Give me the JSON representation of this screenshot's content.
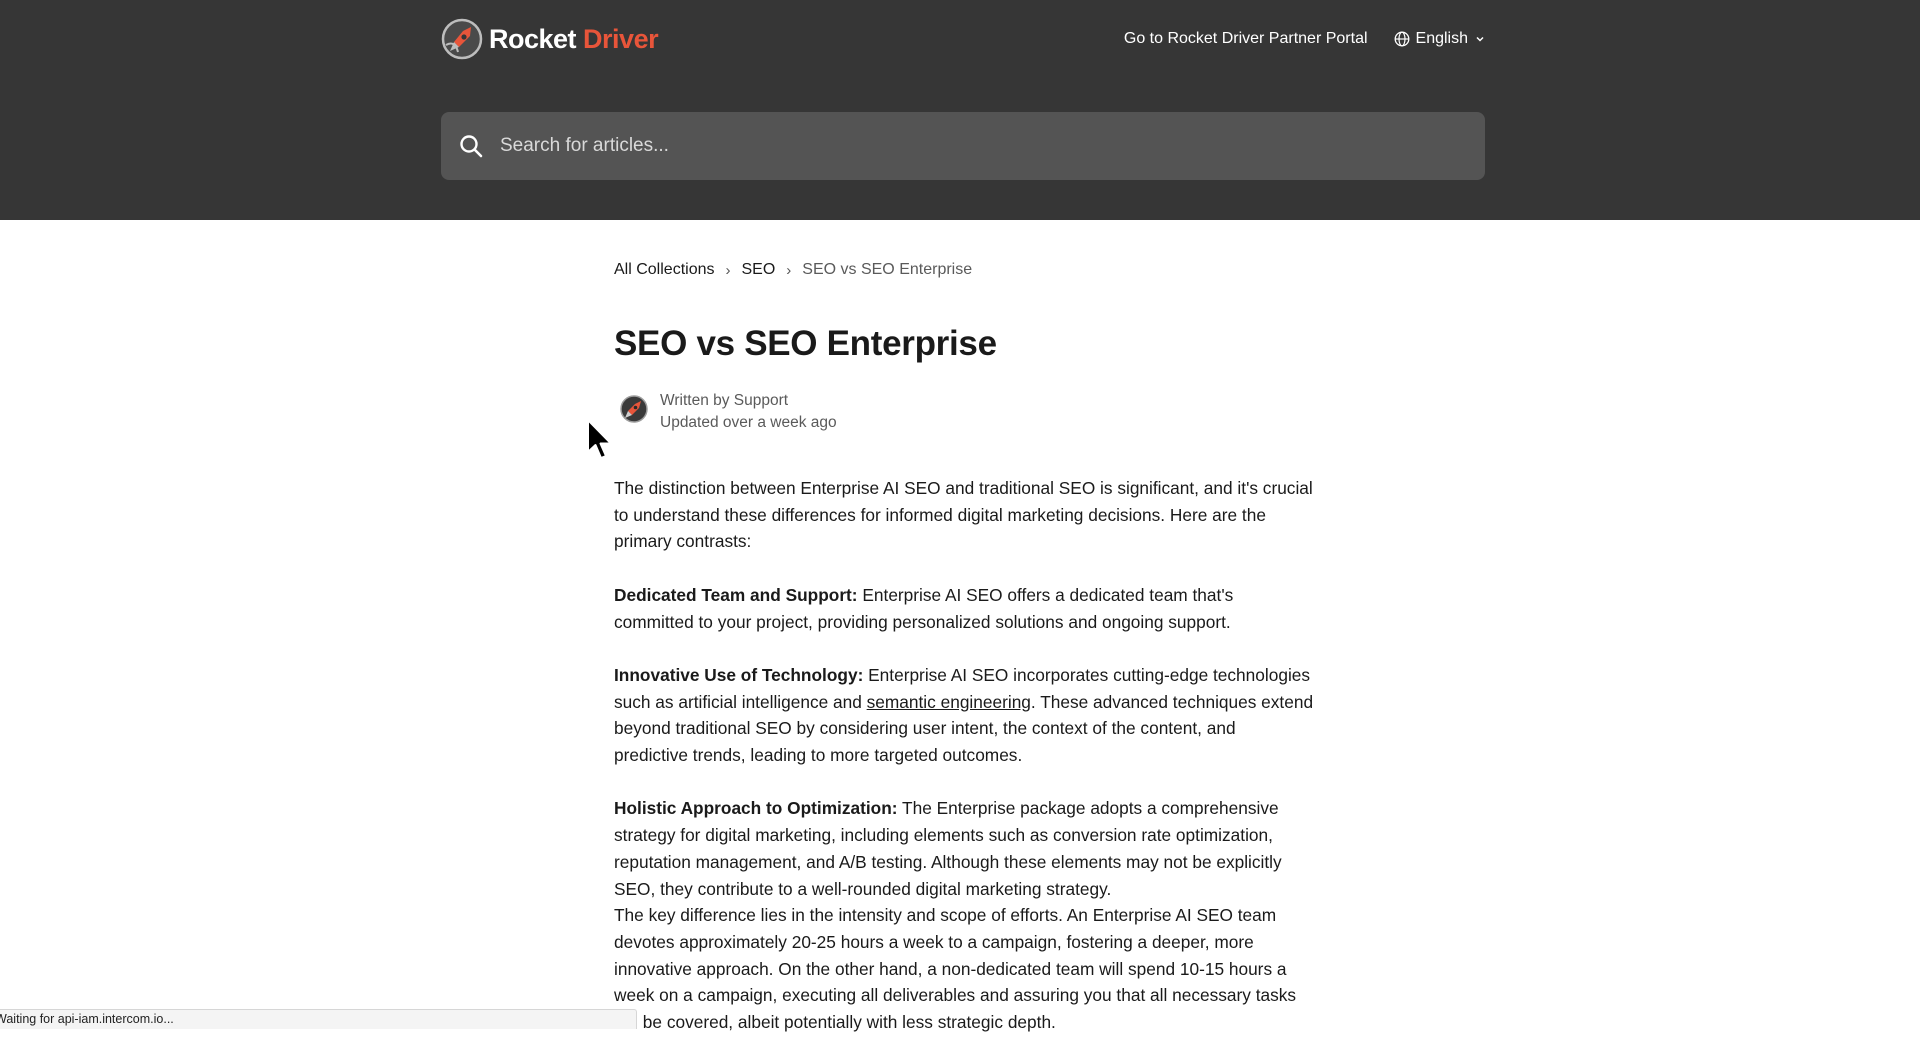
{
  "header": {
    "logo": {
      "word1": "Rocket",
      "word2": "Driver",
      "accent_color": "#e8553a"
    },
    "portal_link": "Go to Rocket Driver Partner Portal",
    "language": "English",
    "icons": {
      "globe": "globe-icon",
      "chevron": "chevron-down-icon",
      "search": "search-icon"
    },
    "background": "#363636"
  },
  "search": {
    "placeholder": "Search for articles..."
  },
  "breadcrumb": {
    "items": [
      "All Collections",
      "SEO"
    ],
    "current": "SEO vs SEO Enterprise",
    "separator": "›"
  },
  "article": {
    "title": "SEO vs SEO Enterprise",
    "written_by": "Written by Support",
    "updated": "Updated over a week ago",
    "intro": "The distinction between Enterprise AI SEO and traditional SEO is significant, and it's crucial to understand these differences for informed digital marketing decisions. Here are the primary contrasts:",
    "sections": [
      {
        "heading": "Dedicated Team and Support:",
        "text": " Enterprise AI SEO offers a dedicated team that's committed to your project, providing personalized solutions and ongoing support."
      },
      {
        "heading": "Innovative Use of Technology:",
        "text_before": " Enterprise AI SEO incorporates cutting-edge technologies such as artificial intelligence and ",
        "link": "semantic engineering",
        "text_after": ". These advanced techniques extend beyond traditional SEO by considering user intent, the context of the content, and predictive trends, leading to more targeted outcomes."
      },
      {
        "heading": "Holistic Approach to Optimization:",
        "text": " The Enterprise package adopts a comprehensive strategy for digital marketing, including elements such as conversion rate optimization, reputation management, and A/B testing. Although these elements may not be explicitly SEO, they contribute to a well-rounded digital marketing strategy."
      }
    ],
    "closing": "The key difference lies in the intensity and scope of efforts. An Enterprise AI SEO team devotes approximately 20-25 hours a week to a campaign, fostering a deeper, more innovative approach. On the other hand, a non-dedicated team will spend 10-15 hours a week on a campaign, executing all deliverables and assuring you that all necessary tasks will be covered, albeit potentially with less strategic depth."
  },
  "status_bar": {
    "text": "Waiting for api-iam.intercom.io..."
  }
}
